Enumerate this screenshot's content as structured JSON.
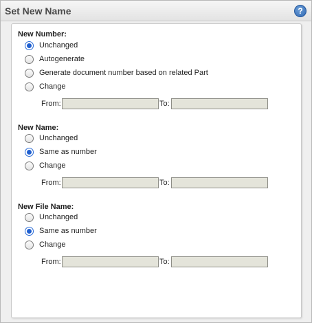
{
  "dialog": {
    "title": "Set New Name"
  },
  "sections": [
    {
      "title": "New Number:",
      "options": [
        "Unchanged",
        "Autogenerate",
        "Generate document number based on related Part",
        "Change"
      ],
      "selected": 0,
      "from_label": "From:",
      "to_label": "To:",
      "from_value": "",
      "to_value": ""
    },
    {
      "title": "New Name:",
      "options": [
        "Unchanged",
        "Same as number",
        "Change"
      ],
      "selected": 1,
      "from_label": "From:",
      "to_label": "To:",
      "from_value": "",
      "to_value": ""
    },
    {
      "title": "New File Name:",
      "options": [
        "Unchanged",
        "Same as number",
        "Change"
      ],
      "selected": 1,
      "from_label": "From:",
      "to_label": "To:",
      "from_value": "",
      "to_value": ""
    }
  ]
}
